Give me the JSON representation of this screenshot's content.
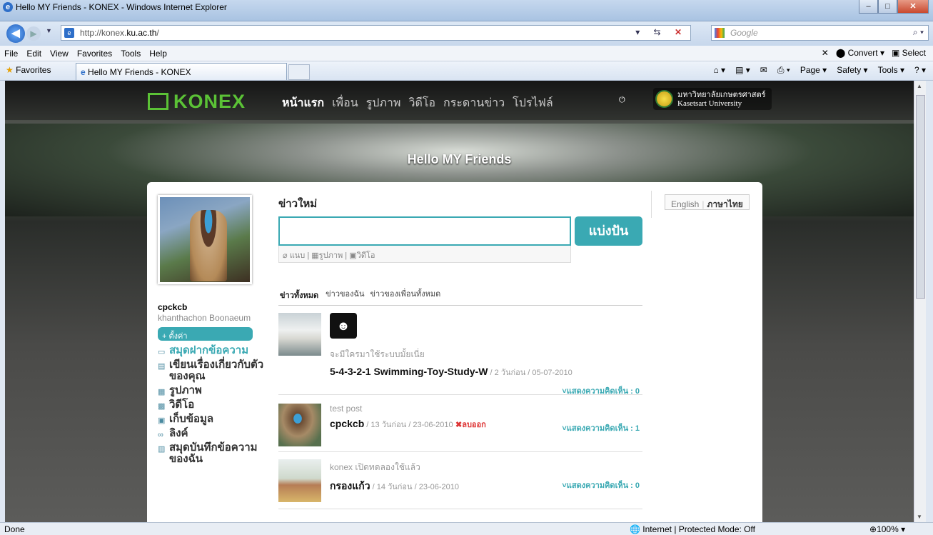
{
  "window": {
    "title": "Hello MY Friends - KONEX - Windows Internet Explorer"
  },
  "address": {
    "url_prefix": "http://konex.",
    "url_domain": "ku.ac.th",
    "url_suffix": "/"
  },
  "search": {
    "placeholder": "Google"
  },
  "menu": [
    "File",
    "Edit",
    "View",
    "Favorites",
    "Tools",
    "Help"
  ],
  "menu_right": {
    "convert": "Convert",
    "select": "Select"
  },
  "favorites": {
    "label": "Favorites",
    "tab": "Hello MY Friends - KONEX"
  },
  "commandbar": {
    "page": "Page ▾",
    "safety": "Safety ▾",
    "tools": "Tools ▾"
  },
  "site": {
    "logo": "KONEX",
    "nav": [
      "หน้าแรก",
      "เพื่อน",
      "รูปภาพ",
      "วิดีโอ",
      "กระดานข่าว",
      "โปรไฟล์"
    ],
    "university_th": "มหาวิทยาลัยเกษตรศาสตร์",
    "university_en": "Kasetsart University",
    "banner": "Hello MY Friends"
  },
  "profile": {
    "username": "cpckcb",
    "fullname": "khanthachon Boonaeum",
    "settings": "+ ตั้งค่า",
    "menu": [
      {
        "label": "สมุดฝากข้อความ",
        "icon": "message-icon",
        "highlight": true
      },
      {
        "label": "เขียนเรื่องเกี่ยวกับตัวของคุณ",
        "icon": "doc-icon",
        "highlight": false
      },
      {
        "label": "รูปภาพ",
        "icon": "photo-icon",
        "highlight": false
      },
      {
        "label": "วิดีโอ",
        "icon": "video-icon",
        "highlight": false
      },
      {
        "label": "เก็บข้อมูล",
        "icon": "storage-icon",
        "highlight": false
      },
      {
        "label": "ลิงค์",
        "icon": "link-icon",
        "highlight": false
      },
      {
        "label": "สมุดบันทึกข้อความของฉัน",
        "icon": "notebook-icon",
        "highlight": false
      }
    ]
  },
  "feed": {
    "title": "ข่าวใหม่",
    "share": "แบ่งปัน",
    "attach": {
      "file": "แนบ",
      "photo": "รูปภาพ",
      "video": "วิดีโอ"
    },
    "tabs": [
      "ข่าวทั้งหมด",
      "ข่าวของฉัน",
      "ข่าวของเพื่อนทั้งหมด"
    ],
    "posts": [
      {
        "text": "จะมีใครมาใช้ระบบมั้ยเนี่ย",
        "author": "5-4-3-2-1 Swimming-Toy-Study-W",
        "meta": " / 2 วันก่อน / 05-07-2010",
        "comments": "˅แสดงความคิดเห็น : 0"
      },
      {
        "text": "test post",
        "author": "cpckcb",
        "meta": " / 13 วันก่อน / 23-06-2010",
        "delete": "✖ลบออก",
        "comments": "˅แสดงความคิดเห็น : 1"
      },
      {
        "text": "konex เปิดทดลองใช้แล้ว",
        "author": "กรองแก้ว",
        "meta": " / 14 วันก่อน / 23-06-2010",
        "comments": "˅แสดงความคิดเห็น : 0"
      }
    ]
  },
  "language": {
    "english": "English",
    "thai": "ภาษาไทย"
  },
  "status": {
    "done": "Done",
    "zone": "Internet | Protected Mode: Off",
    "zoom": "100%"
  }
}
